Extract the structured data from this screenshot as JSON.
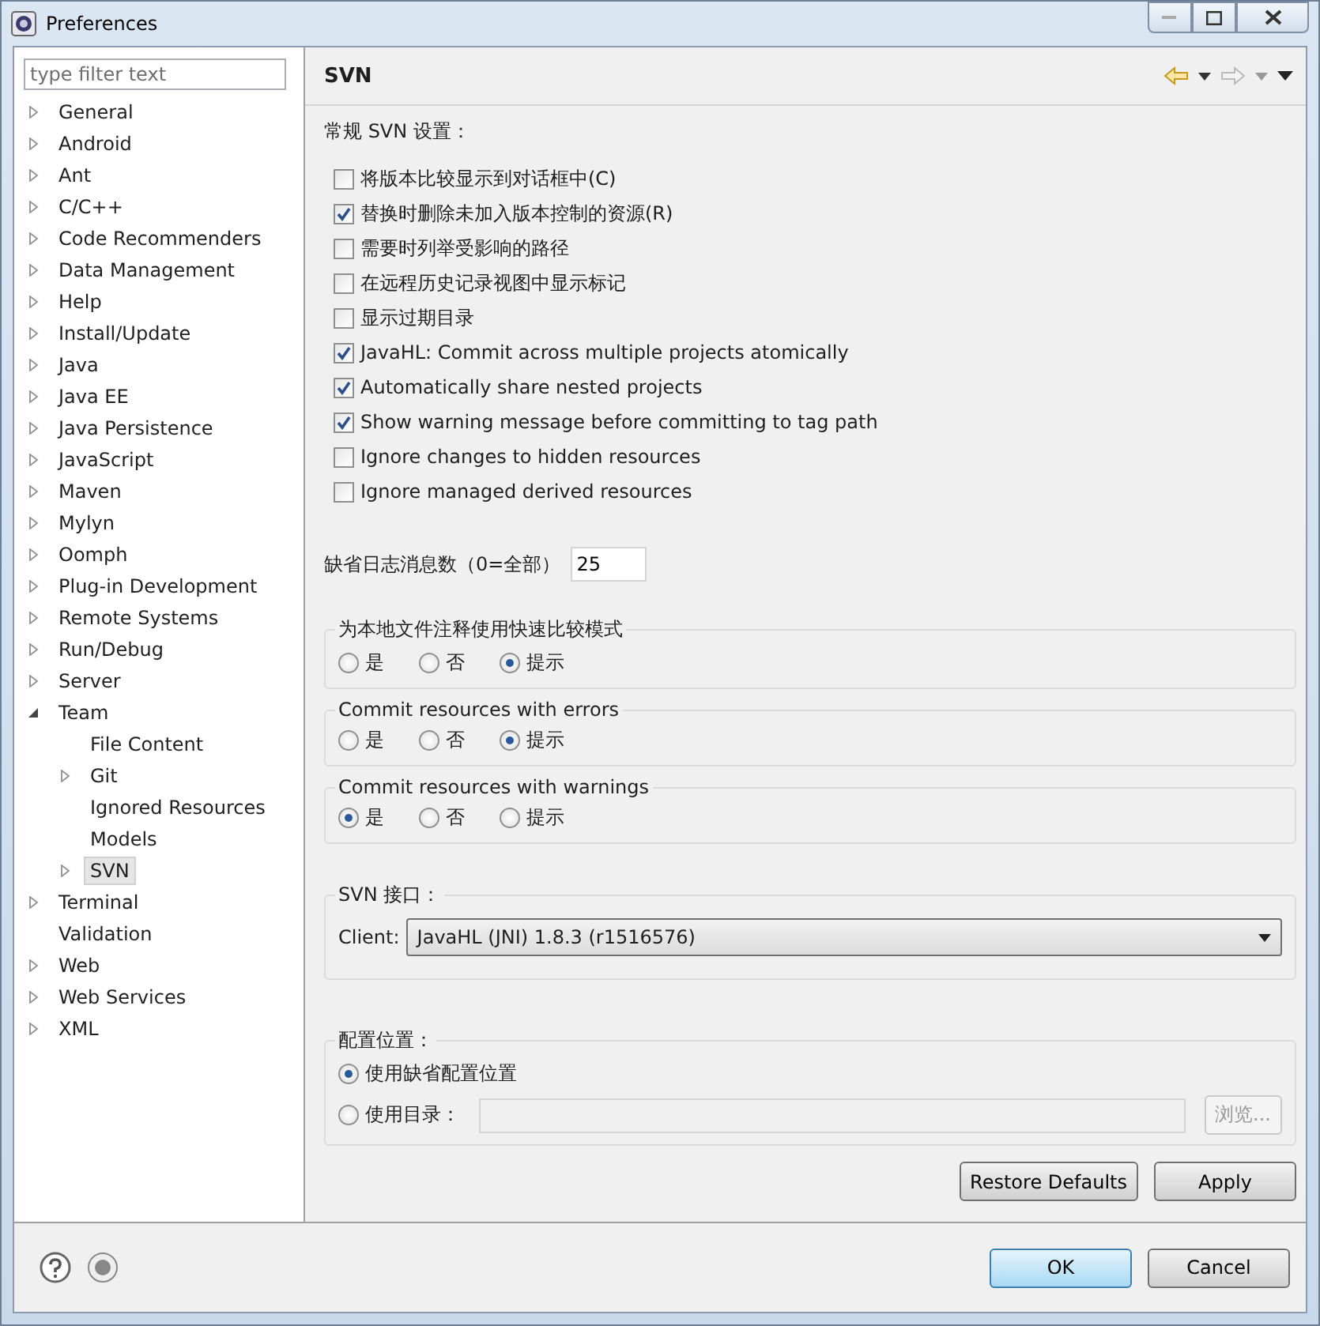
{
  "window": {
    "title": "Preferences"
  },
  "filter": {
    "placeholder": "type filter text"
  },
  "tree": [
    {
      "label": "General",
      "expandable": true,
      "expanded": false,
      "selected": false
    },
    {
      "label": "Android",
      "expandable": true,
      "expanded": false,
      "selected": false
    },
    {
      "label": "Ant",
      "expandable": true,
      "expanded": false,
      "selected": false
    },
    {
      "label": "C/C++",
      "expandable": true,
      "expanded": false,
      "selected": false
    },
    {
      "label": "Code Recommenders",
      "expandable": true,
      "expanded": false,
      "selected": false
    },
    {
      "label": "Data Management",
      "expandable": true,
      "expanded": false,
      "selected": false
    },
    {
      "label": "Help",
      "expandable": true,
      "expanded": false,
      "selected": false
    },
    {
      "label": "Install/Update",
      "expandable": true,
      "expanded": false,
      "selected": false
    },
    {
      "label": "Java",
      "expandable": true,
      "expanded": false,
      "selected": false
    },
    {
      "label": "Java EE",
      "expandable": true,
      "expanded": false,
      "selected": false
    },
    {
      "label": "Java Persistence",
      "expandable": true,
      "expanded": false,
      "selected": false
    },
    {
      "label": "JavaScript",
      "expandable": true,
      "expanded": false,
      "selected": false
    },
    {
      "label": "Maven",
      "expandable": true,
      "expanded": false,
      "selected": false
    },
    {
      "label": "Mylyn",
      "expandable": true,
      "expanded": false,
      "selected": false
    },
    {
      "label": "Oomph",
      "expandable": true,
      "expanded": false,
      "selected": false
    },
    {
      "label": "Plug-in Development",
      "expandable": true,
      "expanded": false,
      "selected": false
    },
    {
      "label": "Remote Systems",
      "expandable": true,
      "expanded": false,
      "selected": false
    },
    {
      "label": "Run/Debug",
      "expandable": true,
      "expanded": false,
      "selected": false
    },
    {
      "label": "Server",
      "expandable": true,
      "expanded": false,
      "selected": false
    },
    {
      "label": "Team",
      "expandable": true,
      "expanded": true,
      "selected": false,
      "children": [
        {
          "label": "File Content",
          "expandable": false,
          "selected": false
        },
        {
          "label": "Git",
          "expandable": true,
          "expanded": false,
          "selected": false
        },
        {
          "label": "Ignored Resources",
          "expandable": false,
          "selected": false
        },
        {
          "label": "Models",
          "expandable": false,
          "selected": false
        },
        {
          "label": "SVN",
          "expandable": true,
          "expanded": false,
          "selected": true
        }
      ]
    },
    {
      "label": "Terminal",
      "expandable": true,
      "expanded": false,
      "selected": false
    },
    {
      "label": "Validation",
      "expandable": false,
      "selected": false
    },
    {
      "label": "Web",
      "expandable": true,
      "expanded": false,
      "selected": false
    },
    {
      "label": "Web Services",
      "expandable": true,
      "expanded": false,
      "selected": false
    },
    {
      "label": "XML",
      "expandable": true,
      "expanded": false,
      "selected": false
    }
  ],
  "page": {
    "title": "SVN",
    "general_heading": "常规 SVN 设置：",
    "options": [
      {
        "label": "将版本比较显示到对话框中(C)",
        "checked": false
      },
      {
        "label": "替换时删除未加入版本控制的资源(R)",
        "checked": true
      },
      {
        "label": "需要时列举受影响的路径",
        "checked": false
      },
      {
        "label": "在远程历史记录视图中显示标记",
        "checked": false
      },
      {
        "label": "显示过期目录",
        "checked": false
      },
      {
        "label": "JavaHL: Commit across multiple projects atomically",
        "checked": true
      },
      {
        "label": "Automatically share nested projects",
        "checked": true
      },
      {
        "label": "Show warning message before committing to tag path",
        "checked": true
      },
      {
        "label": "Ignore changes to hidden resources",
        "checked": false
      },
      {
        "label": "Ignore managed derived resources",
        "checked": false
      }
    ],
    "log_count": {
      "label": "缺省日志消息数（0=全部）",
      "value": "25"
    },
    "radio_groups": [
      {
        "title": "为本地文件注释使用快速比较模式",
        "options": [
          {
            "label": "是",
            "selected": false
          },
          {
            "label": "否",
            "selected": false
          },
          {
            "label": "提示",
            "selected": true
          }
        ]
      },
      {
        "title": "Commit resources with errors",
        "options": [
          {
            "label": "是",
            "selected": false
          },
          {
            "label": "否",
            "selected": false
          },
          {
            "label": "提示",
            "selected": true
          }
        ]
      },
      {
        "title": "Commit resources with warnings",
        "options": [
          {
            "label": "是",
            "selected": true
          },
          {
            "label": "否",
            "selected": false
          },
          {
            "label": "提示",
            "selected": false
          }
        ]
      }
    ],
    "interface": {
      "title": "SVN 接口：",
      "client_label": "Client:",
      "client_value": "JavaHL (JNI) 1.8.3 (r1516576)"
    },
    "config": {
      "title": "配置位置：",
      "options": [
        {
          "label": "使用缺省配置位置",
          "selected": true
        },
        {
          "label": "使用目录：",
          "selected": false
        }
      ],
      "directory_disabled": true,
      "browse_label": "浏览...",
      "browse_disabled": true
    },
    "buttons": [
      "Restore Defaults",
      "Apply"
    ]
  },
  "footer_buttons": [
    {
      "label": "OK",
      "default": true
    },
    {
      "label": "Cancel",
      "default": false
    }
  ]
}
